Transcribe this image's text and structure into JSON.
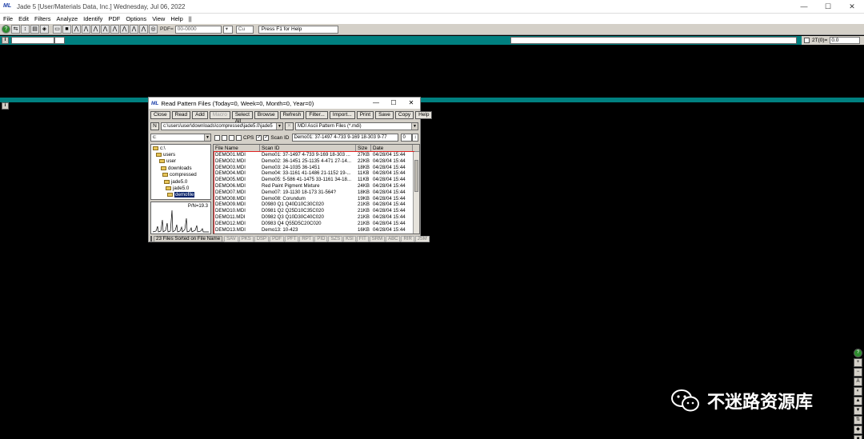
{
  "window": {
    "app_icon_text": "ML",
    "title": "Jade 5 [User/Materials Data, Inc.] Wednesday, Jul 06, 2022",
    "minimize": "—",
    "maximize": "☐",
    "close": "✕"
  },
  "menu": [
    "File",
    "Edit",
    "Filters",
    "Analyze",
    "Identify",
    "PDF",
    "Options",
    "View",
    "Help",
    "||"
  ],
  "toolbar": {
    "pdf_label": "PDF=",
    "pdf_value": "00-0000",
    "element_value": "Cu",
    "status": "Press F1 for Help"
  },
  "twotheta": {
    "label": "2T(0)=",
    "value": "0.0"
  },
  "pane_label": "i",
  "dialog": {
    "app_icon_text": "ML",
    "title": "Read Pattern Files (Today=0, Week=0, Month=0, Year=0)",
    "buttons": [
      "Close",
      "Read",
      "Add",
      "Macro",
      "Select All",
      "Browse",
      "Refresh",
      "Filter...",
      "Import...",
      "Print",
      "Save",
      "Copy",
      "Help"
    ],
    "disabled_button": "Macro",
    "n_button": "N",
    "path": "c:\\users\\user\\downloads\\compressed\\jade5.0\\jade5",
    "filetype": "MDI Ascii Pattern Files (*.mdi)",
    "drive": "c:",
    "cps_label": "CPS",
    "scanid_label": "Scan ID",
    "scanid_value": "Demo01: 37-1497 4-733 9-169 18-303 9-77",
    "counter_value": "0",
    "tree": [
      {
        "label": "c:\\",
        "indent": 0
      },
      {
        "label": "users",
        "indent": 1
      },
      {
        "label": "user",
        "indent": 2
      },
      {
        "label": "downloads",
        "indent": 3
      },
      {
        "label": "compressed",
        "indent": 4
      },
      {
        "label": "jade5.0",
        "indent": 5
      },
      {
        "label": "jade5.0",
        "indent": 6
      },
      {
        "label": "demofile",
        "indent": 7,
        "selected": true
      }
    ],
    "pn_label": "P/N=19.3",
    "columns": [
      "File Name",
      "Scan ID",
      "Size",
      "Date"
    ],
    "files": [
      [
        "DEMO01.MDI",
        "Demo01: 37-1497 4-733 9-169 18-303 ...",
        "27KB",
        "04/28/04 15:44"
      ],
      [
        "DEMO02.MDI",
        "Demo02: 36-1451 25-1135 4-471 27-14...",
        "22KB",
        "04/28/04 15:44"
      ],
      [
        "DEMO03.MDI",
        "Demo03: 24-1035 36-1451",
        "18KB",
        "04/28/04 15:44"
      ],
      [
        "DEMO04.MDI",
        "Demo04: 33-1161 41-1486 21-1152 19-...",
        "11KB",
        "04/28/04 15:44"
      ],
      [
        "DEMO05.MDI",
        "Demo05: 5-586 41-1475 33-1161 34-18...",
        "11KB",
        "04/28/04 15:44"
      ],
      [
        "DEMO06.MDI",
        "Red Paint Pigment Mixture",
        "24KB",
        "04/28/04 15:44"
      ],
      [
        "DEMO07.MDI",
        "Demo07: 19-1130 18-173 31-564?",
        "18KB",
        "04/28/04 15:44"
      ],
      [
        "DEMO08.MDI",
        "Demo08: Corundum",
        "19KB",
        "04/28/04 15:44"
      ],
      [
        "DEMO09.MDI",
        "D0980 Q1 Q40D10C30C020",
        "21KB",
        "04/28/04 15:44"
      ],
      [
        "DEMO10.MDI",
        "D0981 Q2 Q25D10C35C020",
        "21KB",
        "04/28/04 15:44"
      ],
      [
        "DEMO11.MDI",
        "D0982 Q3 Q10D30C40C020",
        "21KB",
        "04/28/04 15:44"
      ],
      [
        "DEMO12.MDI",
        "D0983 Q4 Q55D5C20C020",
        "21KB",
        "04/28/04 15:44"
      ],
      [
        "DEMO13.MDI",
        "Demo13: 10-423",
        "16KB",
        "04/28/04 15:44"
      ]
    ],
    "status_text": "23 Files Sorted on File Name",
    "status_tabs": [
      "SAV",
      "PKS",
      "DSP",
      "PDF",
      "PFT",
      "RPT",
      "PID",
      "SZS",
      "KSI",
      "FIT",
      "SRM",
      "ABC",
      "RIR",
      "JSM"
    ]
  },
  "watermark": {
    "text": "不迷路资源库"
  },
  "colors": {
    "teal": "#008080",
    "highlight": "#e02424",
    "selection": "#0a246a"
  }
}
